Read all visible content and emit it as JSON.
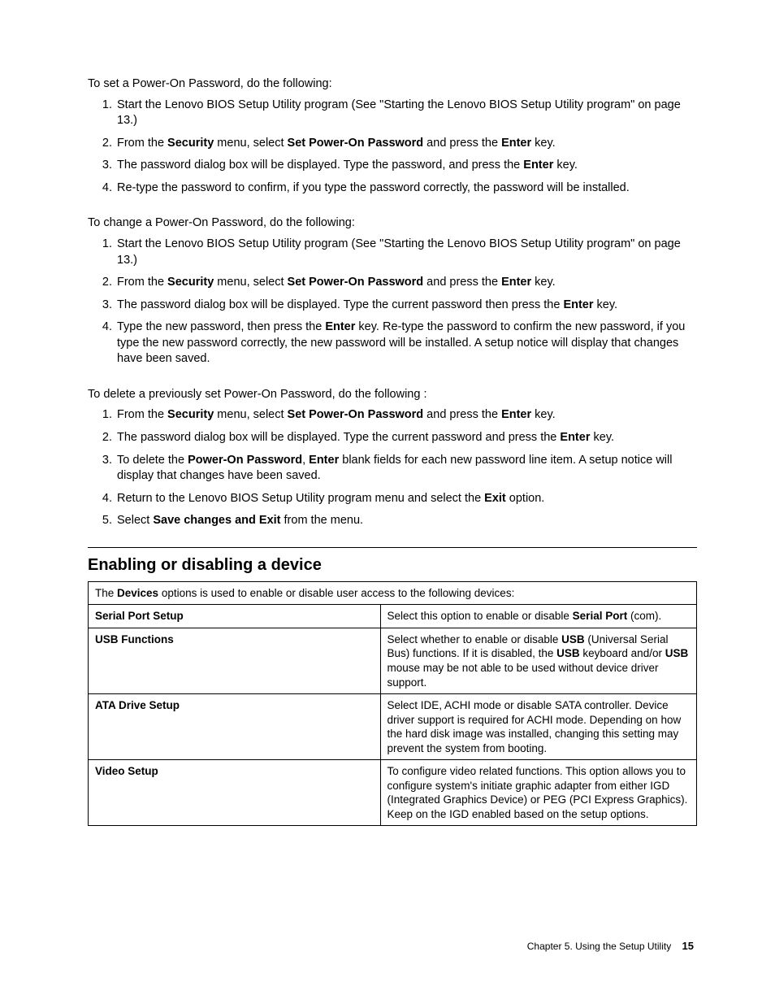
{
  "section1": {
    "intro": "To set a Power-On Password, do the following:",
    "items": [
      {
        "segs": [
          {
            "t": "Start the Lenovo BIOS Setup Utility program (See \"Starting the Lenovo BIOS Setup Utility program\" on page 13.)"
          }
        ]
      },
      {
        "segs": [
          {
            "t": "From the "
          },
          {
            "b": true,
            "t": "Security"
          },
          {
            "t": " menu, select "
          },
          {
            "b": true,
            "t": "Set Power-On Password"
          },
          {
            "t": " and press the "
          },
          {
            "b": true,
            "t": "Enter"
          },
          {
            "t": " key."
          }
        ]
      },
      {
        "segs": [
          {
            "t": "The password dialog box will be displayed. Type the password, and press the "
          },
          {
            "b": true,
            "t": "Enter"
          },
          {
            "t": " key."
          }
        ]
      },
      {
        "segs": [
          {
            "t": "Re-type the password to confirm, if you type the password correctly, the password will be installed."
          }
        ]
      }
    ]
  },
  "section2": {
    "intro": "To change a Power-On Password, do the following:",
    "items": [
      {
        "segs": [
          {
            "t": "Start the Lenovo BIOS Setup Utility program (See \"Starting the Lenovo BIOS Setup Utility program\" on page 13.)"
          }
        ]
      },
      {
        "segs": [
          {
            "t": "From the "
          },
          {
            "b": true,
            "t": "Security"
          },
          {
            "t": " menu, select "
          },
          {
            "b": true,
            "t": "Set Power-On Password"
          },
          {
            "t": " and press the "
          },
          {
            "b": true,
            "t": "Enter"
          },
          {
            "t": " key."
          }
        ]
      },
      {
        "segs": [
          {
            "t": "The password dialog box will be displayed. Type the current password then press the "
          },
          {
            "b": true,
            "t": "Enter"
          },
          {
            "t": " key."
          }
        ]
      },
      {
        "segs": [
          {
            "t": "Type the new password, then press the "
          },
          {
            "b": true,
            "t": "Enter"
          },
          {
            "t": " key. Re-type the password to confirm the new password, if you type the new password correctly, the new password will be installed. A setup notice will display that changes have been saved."
          }
        ]
      }
    ]
  },
  "section3": {
    "intro": "To delete a previously set Power-On Password, do the following :",
    "items": [
      {
        "segs": [
          {
            "t": "From the "
          },
          {
            "b": true,
            "t": "Security"
          },
          {
            "t": " menu, select "
          },
          {
            "b": true,
            "t": "Set Power-On Password"
          },
          {
            "t": " and press the "
          },
          {
            "b": true,
            "t": "Enter"
          },
          {
            "t": " key."
          }
        ]
      },
      {
        "segs": [
          {
            "t": "The password dialog box will be displayed. Type the current password and press the "
          },
          {
            "b": true,
            "t": "Enter"
          },
          {
            "t": " key."
          }
        ]
      },
      {
        "segs": [
          {
            "t": "To delete the "
          },
          {
            "b": true,
            "t": "Power-On Password"
          },
          {
            "t": ", "
          },
          {
            "b": true,
            "t": "Enter"
          },
          {
            "t": " blank fields for each new password line item. A setup notice will display that changes have been saved."
          }
        ]
      },
      {
        "segs": [
          {
            "t": "Return to the Lenovo BIOS Setup Utility program menu and select the "
          },
          {
            "b": true,
            "t": "Exit"
          },
          {
            "t": " option."
          }
        ]
      },
      {
        "segs": [
          {
            "t": "Select "
          },
          {
            "b": true,
            "t": "Save changes and Exit"
          },
          {
            "t": " from the menu."
          }
        ]
      }
    ]
  },
  "heading": "Enabling or disabling a device",
  "table": {
    "header": {
      "segs": [
        {
          "t": "The "
        },
        {
          "b": true,
          "t": "Devices"
        },
        {
          "t": " options is used to enable or disable user access to the following devices:"
        }
      ]
    },
    "rows": [
      {
        "label": "Serial Port Setup",
        "desc": {
          "segs": [
            {
              "t": "Select this option to enable or disable "
            },
            {
              "b": true,
              "t": "Serial Port"
            },
            {
              "t": " (com)."
            }
          ]
        }
      },
      {
        "label": "USB Functions",
        "desc": {
          "segs": [
            {
              "t": "Select whether to enable or disable "
            },
            {
              "b": true,
              "t": "USB"
            },
            {
              "t": " (Universal Serial Bus) functions. If it is disabled, the "
            },
            {
              "b": true,
              "t": "USB"
            },
            {
              "t": " keyboard and/or "
            },
            {
              "b": true,
              "t": "USB"
            },
            {
              "t": " mouse may be not able to be used without device driver support."
            }
          ]
        }
      },
      {
        "label": "ATA Drive Setup",
        "desc": {
          "segs": [
            {
              "t": "Select IDE, ACHI mode or disable SATA controller. Device driver support is required for ACHI mode. Depending on how the hard disk image was installed, changing this setting may prevent the system from booting."
            }
          ]
        }
      },
      {
        "label": "Video Setup",
        "desc": {
          "segs": [
            {
              "t": "To configure video related functions. This option allows you to configure system's initiate graphic adapter from either IGD (Integrated Graphics Device) or PEG (PCI Express Graphics). Keep on the IGD enabled based on the setup options."
            }
          ]
        }
      }
    ]
  },
  "footer": {
    "chapter": "Chapter 5. Using the Setup Utility",
    "page": "15"
  }
}
